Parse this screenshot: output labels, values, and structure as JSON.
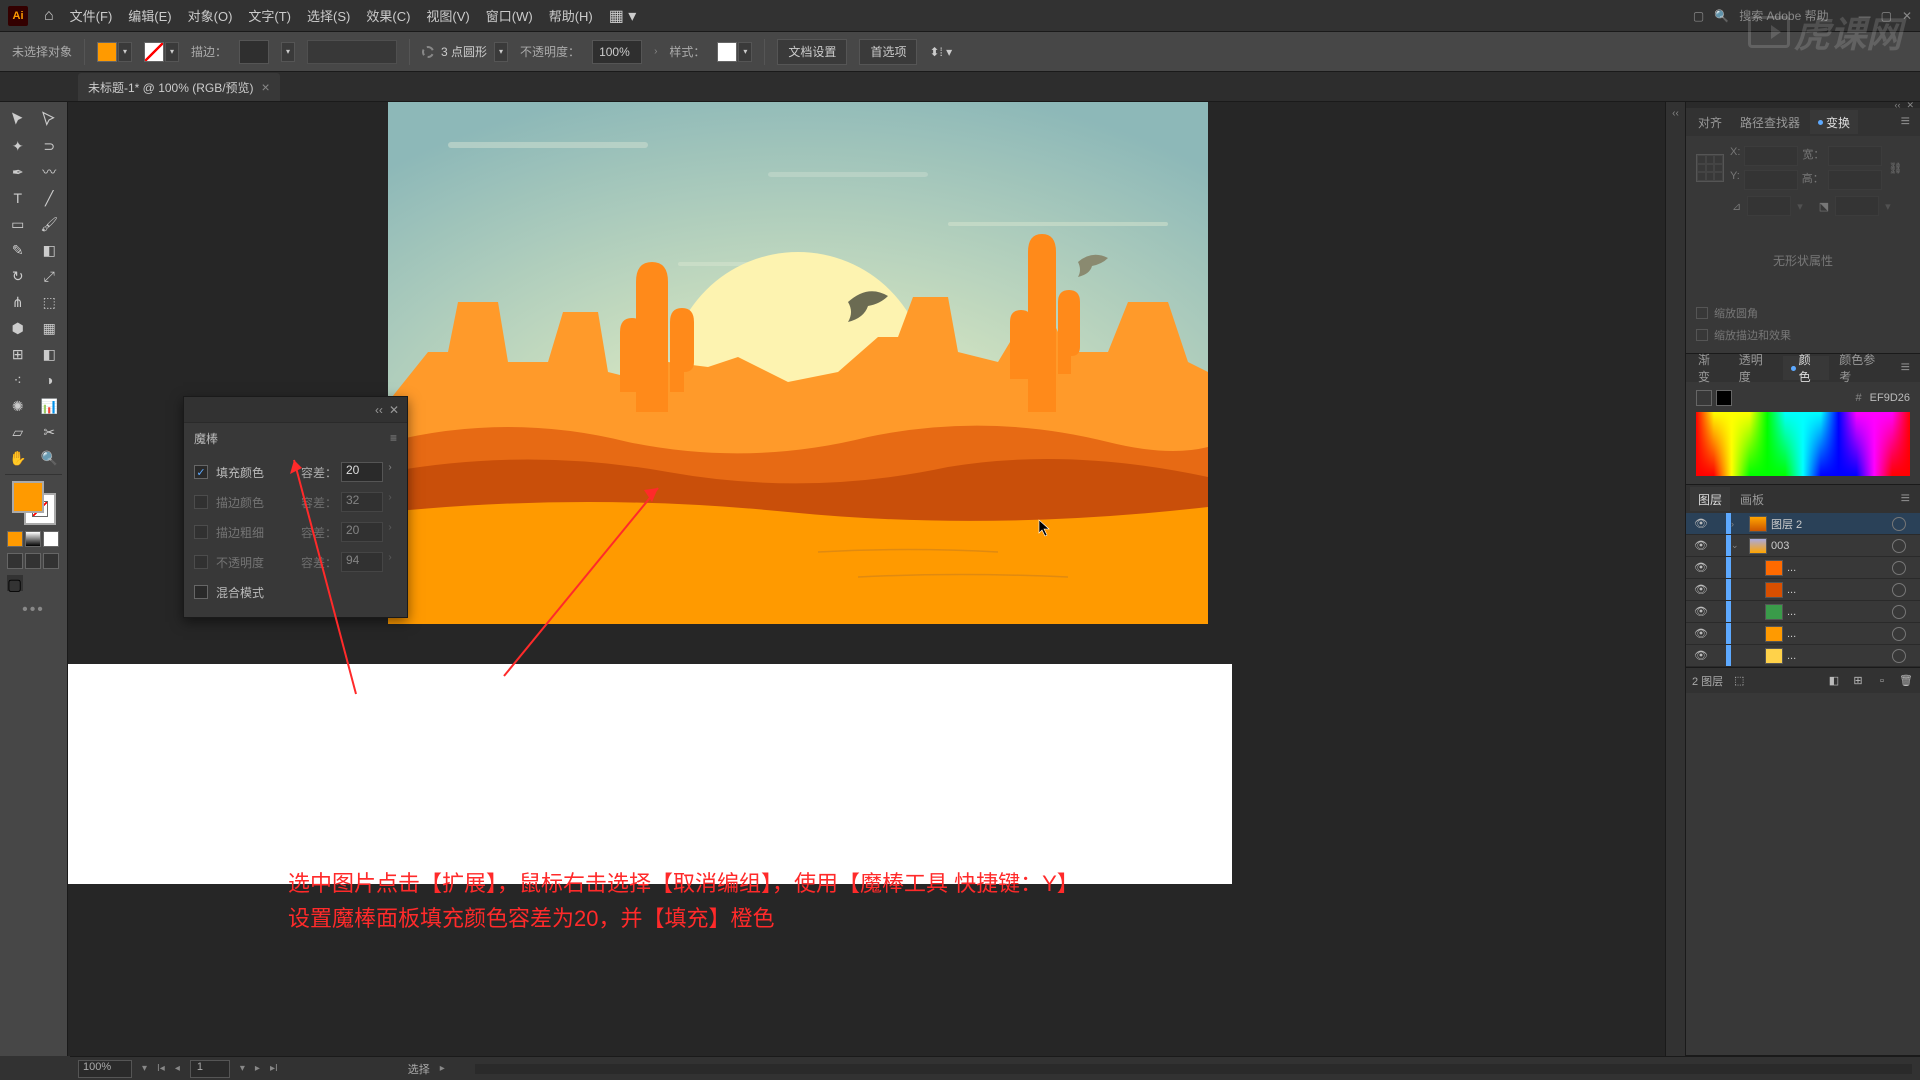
{
  "menubar": {
    "items": [
      "文件(F)",
      "编辑(E)",
      "对象(O)",
      "文字(T)",
      "选择(S)",
      "效果(C)",
      "视图(V)",
      "窗口(W)",
      "帮助(H)"
    ],
    "search_placeholder": "搜索 Adobe 帮助"
  },
  "controlbar": {
    "selection_label": "未选择对象",
    "stroke_label": "描边：",
    "dash_label": "3 点圆形",
    "opacity_label": "不透明度：",
    "opacity_value": "100%",
    "style_label": "样式：",
    "doc_setup": "文档设置",
    "prefs": "首选项"
  },
  "tab": {
    "title": "未标题-1* @ 100% (RGB/预览)"
  },
  "magic_wand": {
    "title": "魔棒",
    "fill_color": "填充颜色",
    "tolerance_label": "容差：",
    "tolerance_value": "20",
    "stroke_color": "描边颜色",
    "stroke_color_val": "32",
    "stroke_weight": "描边粗细",
    "stroke_weight_val": "20",
    "opacity": "不透明度",
    "opacity_val": "94",
    "blend_mode": "混合模式"
  },
  "instruction": {
    "line1": "选中图片点击【扩展】，鼠标右击选择【取消编组】，使用【魔棒工具 快捷键：Y】",
    "line2": "设置魔棒面板填充颜色容差为20，并【填充】橙色"
  },
  "right": {
    "align": "对齐",
    "pathfinder": "路径查找器",
    "transform": "变换",
    "transform_x": "X:",
    "transform_y": "Y:",
    "transform_w": "宽：",
    "transform_h": "高：",
    "transform_angle": "⊿",
    "no_shape_attr": "无形状属性",
    "scale_corners": "缩放圆角",
    "scale_strokes": "缩放描边和效果",
    "gradient": "渐变",
    "transparency": "透明度",
    "color": "颜色",
    "color_guide": "颜色参考",
    "hex": "EF9D26",
    "layers": "图层",
    "artboards": "画板",
    "layer_items": [
      {
        "name": "图层 2",
        "color": "#5da9ff",
        "indent": 0,
        "expand": "›",
        "thumb": "linear-gradient(#ffa500,#cc5500)",
        "selected": true
      },
      {
        "name": "003",
        "color": "#5da9ff",
        "indent": 0,
        "expand": "⌄",
        "thumb": "linear-gradient(#aad,#ffa500)"
      },
      {
        "name": "...",
        "color": "#5da9ff",
        "indent": 1,
        "expand": "",
        "thumb": "#ff6a00"
      },
      {
        "name": "...",
        "color": "#5da9ff",
        "indent": 1,
        "expand": "",
        "thumb": "#d94f00"
      },
      {
        "name": "...",
        "color": "#5da9ff",
        "indent": 1,
        "expand": "",
        "thumb": "#3a9b4a"
      },
      {
        "name": "...",
        "color": "#5da9ff",
        "indent": 1,
        "expand": "",
        "thumb": "#ff9a00"
      },
      {
        "name": "...",
        "color": "#5da9ff",
        "indent": 1,
        "expand": "",
        "thumb": "#ffd24a"
      }
    ],
    "layers_count": "2 图层"
  },
  "statusbar": {
    "zoom": "100%",
    "page": "1",
    "mode": "选择"
  },
  "watermark": "虎课网"
}
